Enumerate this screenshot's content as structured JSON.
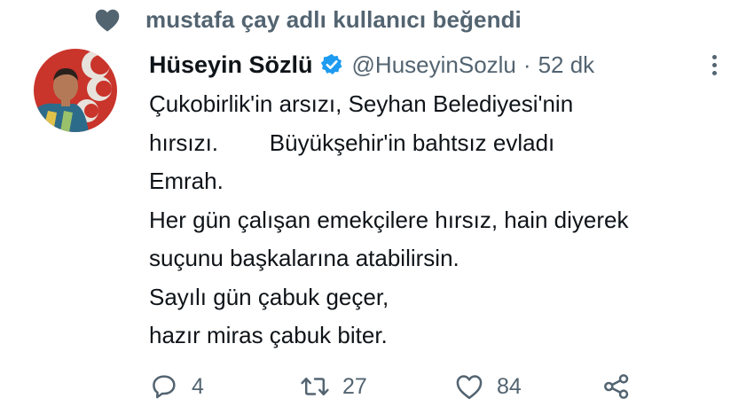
{
  "social_context": {
    "text": "mustafa çay adlı kullanıcı beğendi",
    "icon": "heart-icon"
  },
  "tweet": {
    "author": {
      "display_name": "Hüseyin Sözlü",
      "handle": "@HuseyinSozlu",
      "verified": true
    },
    "separator": "·",
    "time": "52 dk",
    "lines": [
      "Çukobirlik'in arsızı, Seyhan Belediyesi'nin",
      "hırsızı.        Büyükşehir'in bahtsız evladı",
      "Emrah.",
      "Her gün çalışan emekçilere hırsız, hain diyerek",
      "suçunu başkalarına atabilirsin.",
      "Sayılı gün çabuk geçer,",
      "hazır miras çabuk biter."
    ],
    "actions": {
      "reply_count": "4",
      "retweet_count": "27",
      "like_count": "84"
    }
  },
  "colors": {
    "verified_blue": "#1d9bf0",
    "secondary_text": "#536471",
    "primary_text": "#0f1419"
  }
}
